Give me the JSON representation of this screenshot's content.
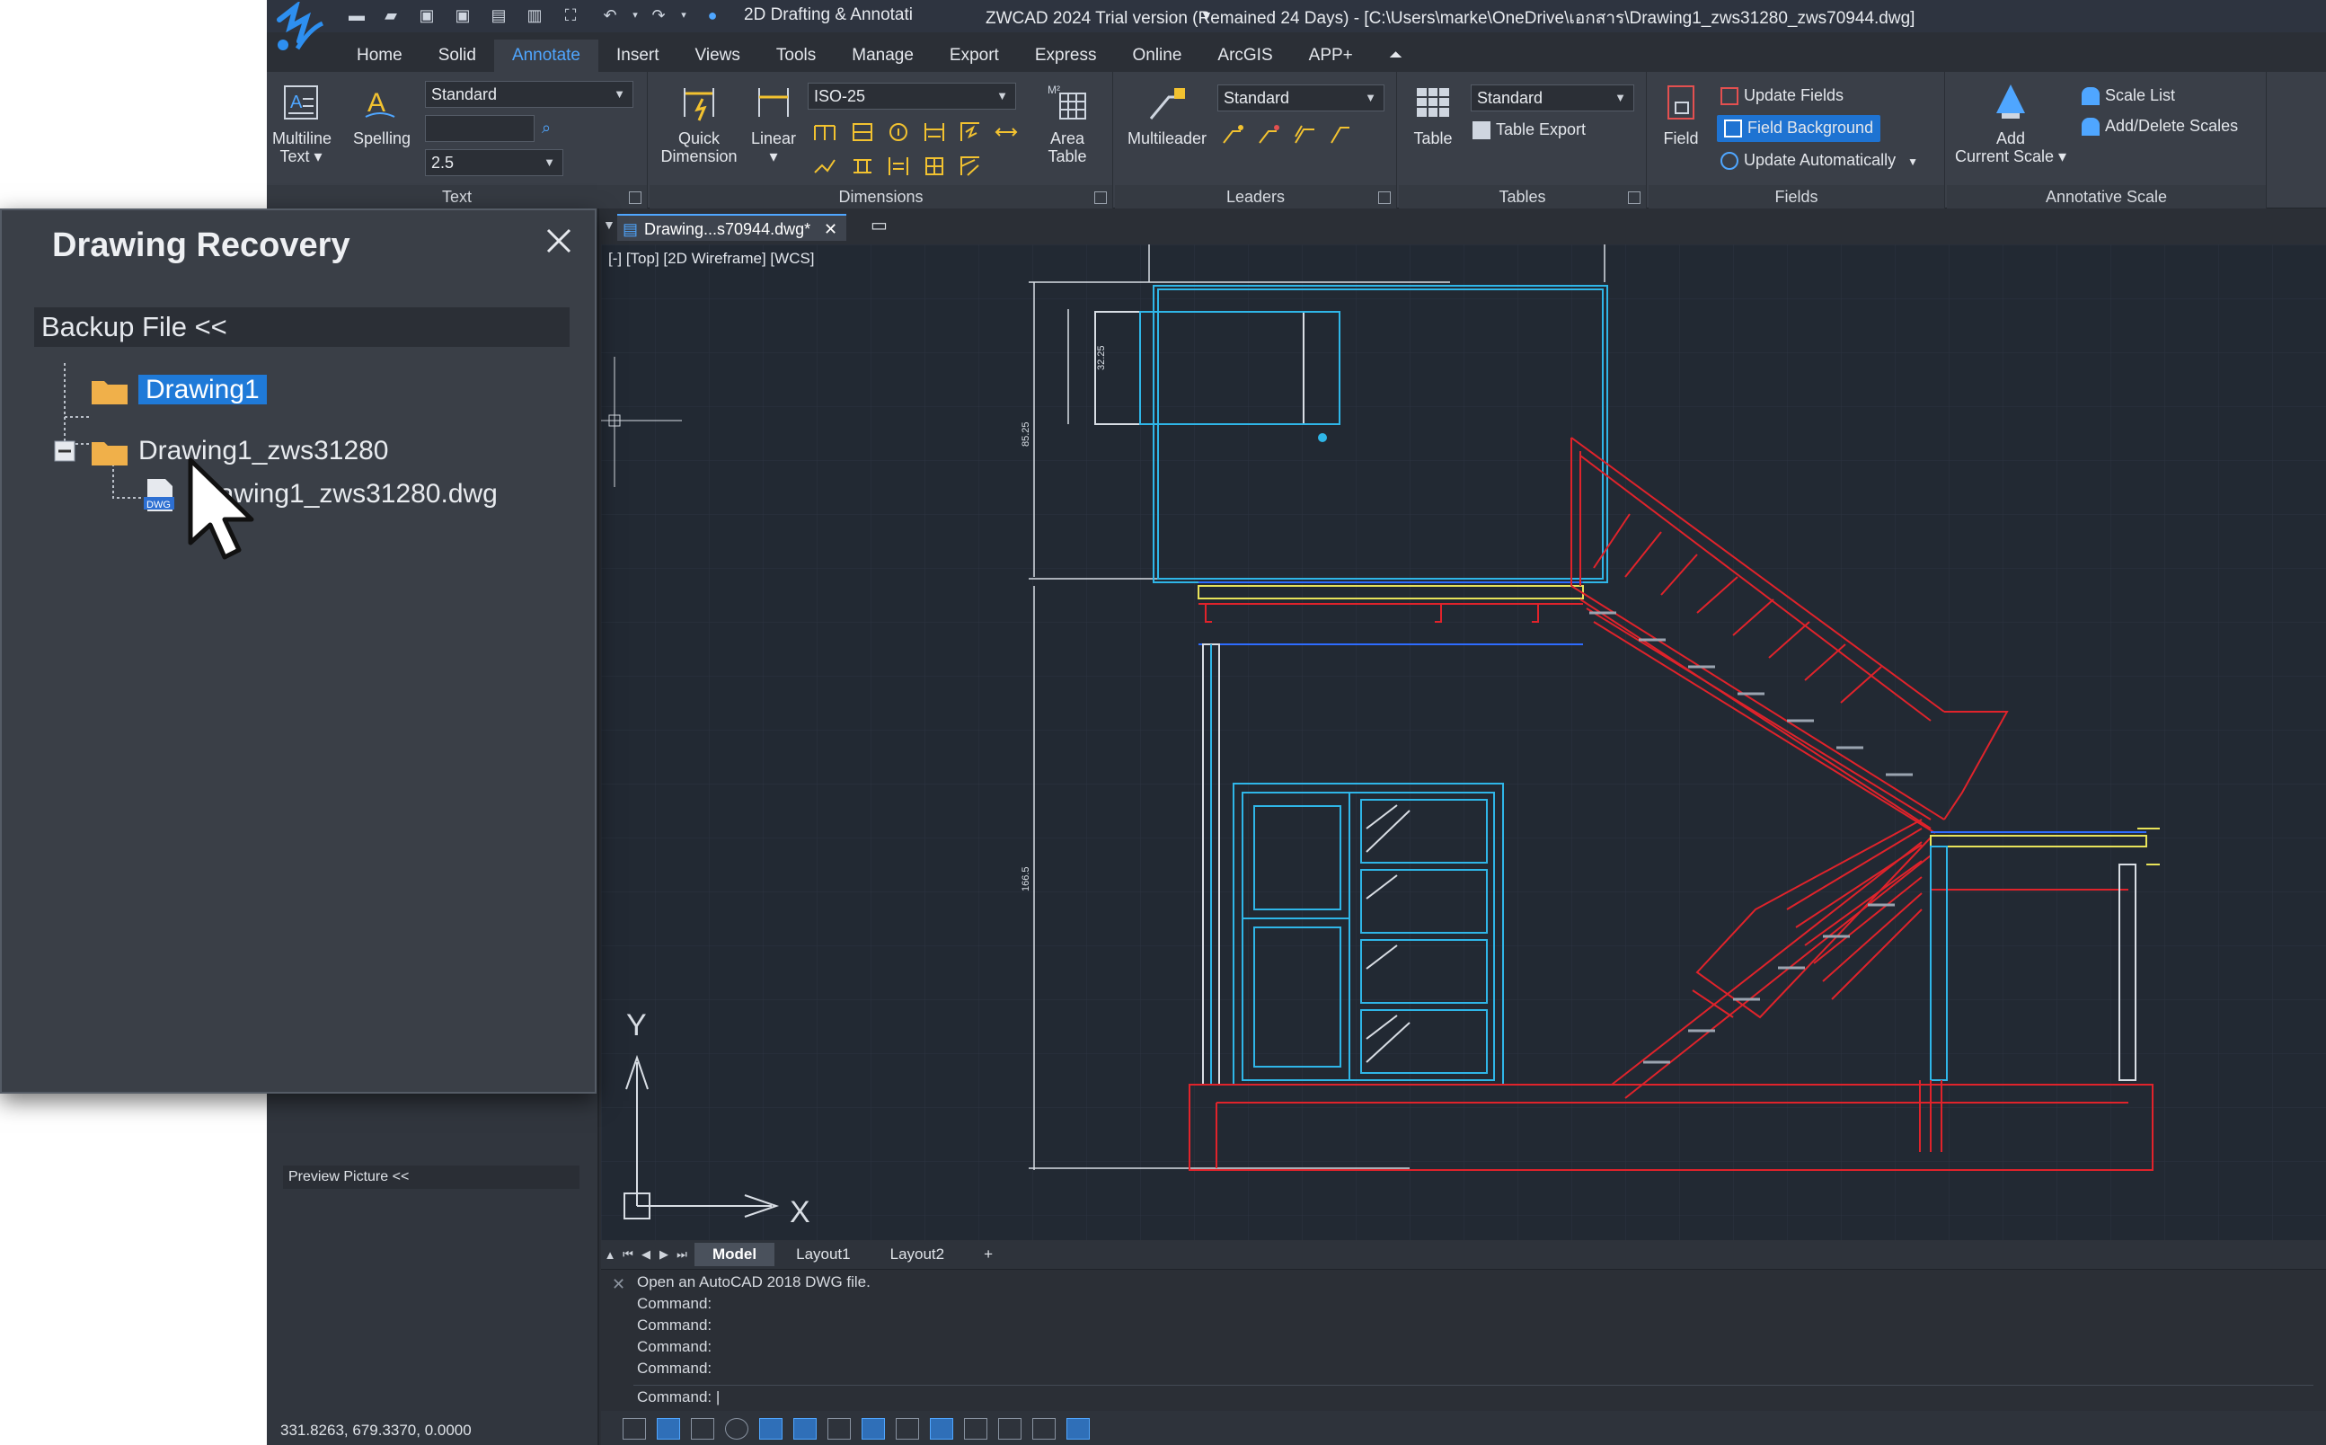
{
  "titlebar": {
    "workspace": "2D Drafting & Annotati",
    "window_title": "ZWCAD 2024 Trial version (Remained 24 Days) - [C:\\Users\\marke\\OneDrive\\เอกสาร\\Drawing1_zws31280_zws70944.dwg]"
  },
  "ribbon_tabs": [
    "Home",
    "Solid",
    "Annotate",
    "Insert",
    "Views",
    "Tools",
    "Manage",
    "Export",
    "Express",
    "Online",
    "ArcGIS",
    "APP+"
  ],
  "ribbon": {
    "text_panel": {
      "label": "Text",
      "multiline": "Multiline",
      "multiline2": "Text ▾",
      "spelling": "Spelling",
      "style": "Standard",
      "height": "2.5"
    },
    "dimensions_panel": {
      "label": "Dimensions",
      "quick": "Quick",
      "quick2": "Dimension",
      "linear": "Linear",
      "linear2": "▾",
      "style": "ISO-25",
      "area": "Area",
      "area2": "Table"
    },
    "leaders_panel": {
      "label": "Leaders",
      "multileader": "Multileader",
      "style": "Standard"
    },
    "tables_panel": {
      "label": "Tables",
      "table": "Table",
      "style": "Standard",
      "export": "Table Export"
    },
    "fields_panel": {
      "label": "Fields",
      "field": "Field",
      "update": "Update Fields",
      "background": "Field Background",
      "auto": "Update Automatically"
    },
    "scale_panel": {
      "label": "Annotative Scale",
      "add": "Add",
      "add2": "Current Scale ▾",
      "list": "Scale List",
      "adddel": "Add/Delete Scales"
    }
  },
  "document": {
    "tab": "Drawing...s70944.dwg*",
    "view_label": "[-] [Top] [2D Wireframe] [WCS]",
    "dims": {
      "d1": "32.25",
      "d2": "85.25",
      "d3": "166.5"
    },
    "ucs_x": "X",
    "ucs_y": "Y"
  },
  "layout_tabs": [
    "Model",
    "Layout1",
    "Layout2",
    "+"
  ],
  "command": {
    "lines": [
      "Open an AutoCAD 2018 DWG file.",
      "Command:",
      "Command:",
      "Command:",
      "Command:"
    ],
    "prompt": "Command:"
  },
  "side_panel": {
    "preview": "Preview Picture <<",
    "coords": "331.8263, 679.3370, 0.0000"
  },
  "dialog": {
    "title": "Drawing Recovery",
    "backup_header": "Backup File <<",
    "tree": [
      {
        "label": "Drawing1",
        "selected": true
      },
      {
        "label": "Drawing1_zws31280",
        "selected": false
      },
      {
        "label": "Drawing1_zws31280.dwg",
        "selected": false
      }
    ]
  },
  "colors": {
    "accent": "#1f7ad8",
    "stair": "#e0232b",
    "cabinet": "#2fb6e8"
  }
}
